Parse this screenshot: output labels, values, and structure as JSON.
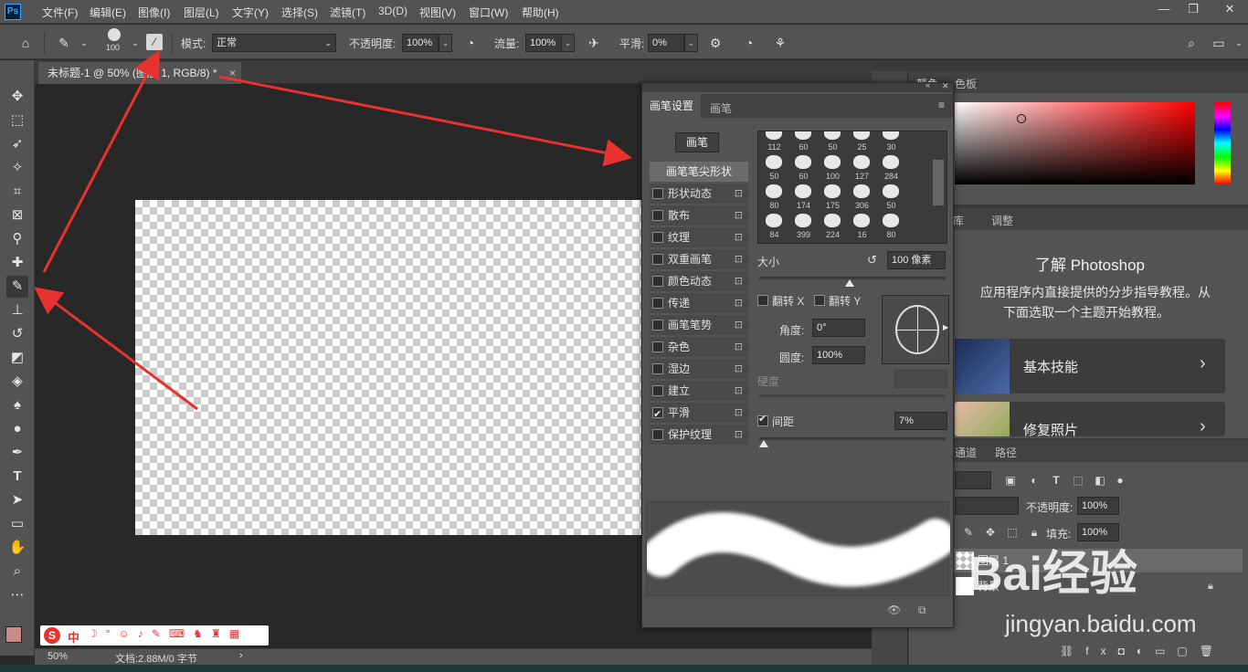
{
  "app": {
    "logo": "Ps"
  },
  "menu": [
    "文件(F)",
    "编辑(E)",
    "图像(I)",
    "图层(L)",
    "文字(Y)",
    "选择(S)",
    "滤镜(T)",
    "3D(D)",
    "视图(V)",
    "窗口(W)",
    "帮助(H)"
  ],
  "window_controls": {
    "minimize": "—",
    "restore": "❐",
    "close": "✕"
  },
  "options": {
    "brush_size": "100",
    "mode_label": "模式:",
    "mode_value": "正常",
    "opacity_label": "不透明度:",
    "opacity_value": "100%",
    "flow_label": "流量:",
    "flow_value": "100%",
    "smoothing_label": "平滑:",
    "smoothing_value": "0%"
  },
  "document": {
    "tab_title": "未标题-1 @ 50% (图层 1, RGB/8) *",
    "tab_close": "×",
    "zoom": "50%",
    "doc_info": "文档:2.88M/0 字节",
    "status_arrow": "›"
  },
  "brush_settings": {
    "tabs": [
      "画笔设置",
      "画笔"
    ],
    "brush_button": "画笔",
    "tip_shape_label": "画笔笔尖形状",
    "options": [
      {
        "label": "形状动态",
        "checked": false
      },
      {
        "label": "散布",
        "checked": false
      },
      {
        "label": "纹理",
        "checked": false
      },
      {
        "label": "双重画笔",
        "checked": false
      },
      {
        "label": "颜色动态",
        "checked": false
      },
      {
        "label": "传递",
        "checked": false
      },
      {
        "label": "画笔笔势",
        "checked": false
      },
      {
        "label": "杂色",
        "checked": false
      },
      {
        "label": "湿边",
        "checked": false
      },
      {
        "label": "建立",
        "checked": false
      },
      {
        "label": "平滑",
        "checked": true
      },
      {
        "label": "保护纹理",
        "checked": false
      }
    ],
    "tip_sizes": [
      "112",
      "60",
      "50",
      "25",
      "30",
      "50",
      "60",
      "100",
      "127",
      "284",
      "80",
      "174",
      "175",
      "306",
      "50",
      "84",
      "399",
      "224",
      "16",
      "80"
    ],
    "size_label": "大小",
    "size_value": "100 像素",
    "flip_x_label": "翻转 X",
    "flip_y_label": "翻转 Y",
    "angle_label": "角度:",
    "angle_value": "0°",
    "roundness_label": "圆度:",
    "roundness_value": "100%",
    "hardness_label": "硬度",
    "spacing_label": "间距",
    "spacing_value": "7%",
    "spacing_checked": true
  },
  "color_panel": {
    "tab_partial": "色板",
    "top_tab_partial": "颜色"
  },
  "learn_panel": {
    "tabs": [
      "库",
      "调整"
    ],
    "title": "了解 Photoshop",
    "desc_line1": "应用程序内直接提供的分步指导教程。从",
    "desc_line2": "下面选取一个主题开始教程。",
    "cards": [
      "基本技能",
      "修复照片"
    ]
  },
  "layers_panel": {
    "tabs": [
      "通道",
      "路径"
    ],
    "opacity_label": "不透明度:",
    "opacity_value": "100%",
    "fill_label": "填充:",
    "fill_value": "100%",
    "layers": [
      "图层 1",
      "背景"
    ]
  },
  "watermark": {
    "text": "Bai经验",
    "url": "jingyan.baidu.com"
  },
  "ime": {
    "label": "中"
  },
  "colors": {
    "foreground": "#c98b87",
    "background": "#ffffff",
    "annotation_arrow": "#e8322f"
  }
}
